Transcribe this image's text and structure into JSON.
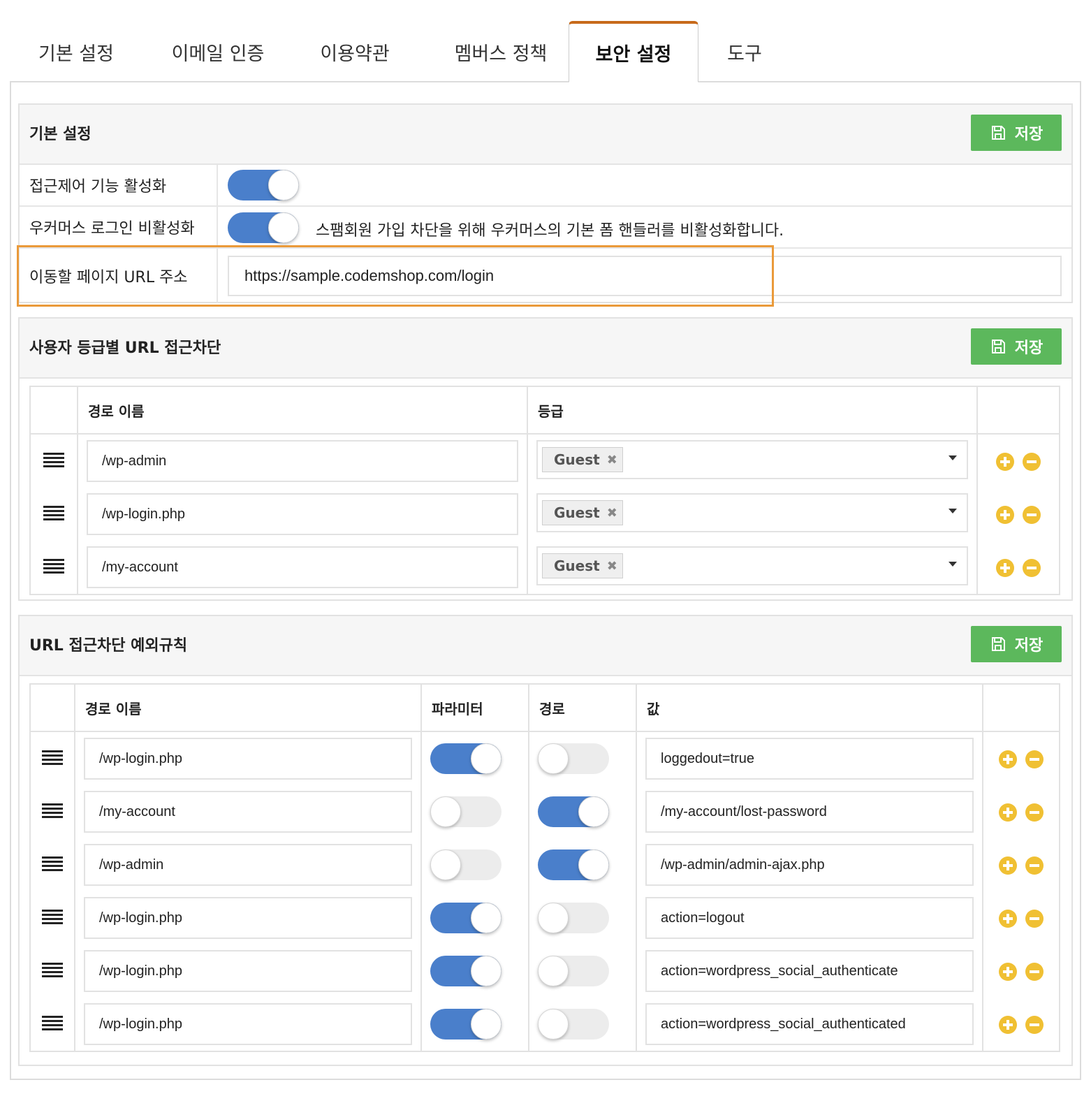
{
  "tabs": [
    {
      "label": "기본 설정"
    },
    {
      "label": "이메일 인증"
    },
    {
      "label": "이용약관"
    },
    {
      "label": "멤버스 정책"
    },
    {
      "label": "보안 설정",
      "active": true
    },
    {
      "label": "도구"
    }
  ],
  "save_label": "저장",
  "basic": {
    "title": "기본 설정",
    "rows": [
      {
        "label": "접근제어 기능 활성화",
        "toggle": "on"
      },
      {
        "label": "우커머스 로그인 비활성화",
        "toggle": "on",
        "description": "스팸회원 가입 차단을 위해 우커머스의 기본 폼 핸들러를 비활성화합니다."
      },
      {
        "label": "이동할 페이지 URL 주소",
        "value": "https://sample.codemshop.com/login"
      }
    ]
  },
  "role_block": {
    "title": "사용자 등급별 URL 접근차단",
    "headers": {
      "path": "경로 이름",
      "grade": "등급"
    },
    "rows": [
      {
        "path": "/wp-admin",
        "grade": "Guest"
      },
      {
        "path": "/wp-login.php",
        "grade": "Guest"
      },
      {
        "path": "/my-account",
        "grade": "Guest"
      }
    ]
  },
  "exceptions": {
    "title": "URL 접근차단 예외규칙",
    "headers": {
      "path": "경로 이름",
      "param": "파라미터",
      "route": "경로",
      "value": "값"
    },
    "rows": [
      {
        "path": "/wp-login.php",
        "param": "on",
        "route": "off",
        "value": "loggedout=true"
      },
      {
        "path": "/my-account",
        "param": "off",
        "route": "on",
        "value": "/my-account/lost-password"
      },
      {
        "path": "/wp-admin",
        "param": "off",
        "route": "on",
        "value": "/wp-admin/admin-ajax.php"
      },
      {
        "path": "/wp-login.php",
        "param": "on",
        "route": "off",
        "value": "action=logout"
      },
      {
        "path": "/wp-login.php",
        "param": "on",
        "route": "off",
        "value": "action=wordpress_social_authenticate"
      },
      {
        "path": "/wp-login.php",
        "param": "on",
        "route": "off",
        "value": "action=wordpress_social_authenticated"
      }
    ]
  },
  "colors": {
    "accent_tab": "#c76a1b",
    "save_green": "#5cb85c",
    "toggle_on": "#4a7fcb",
    "action_yellow": "#f0c033",
    "highlight_orange": "#ea9a3a"
  }
}
